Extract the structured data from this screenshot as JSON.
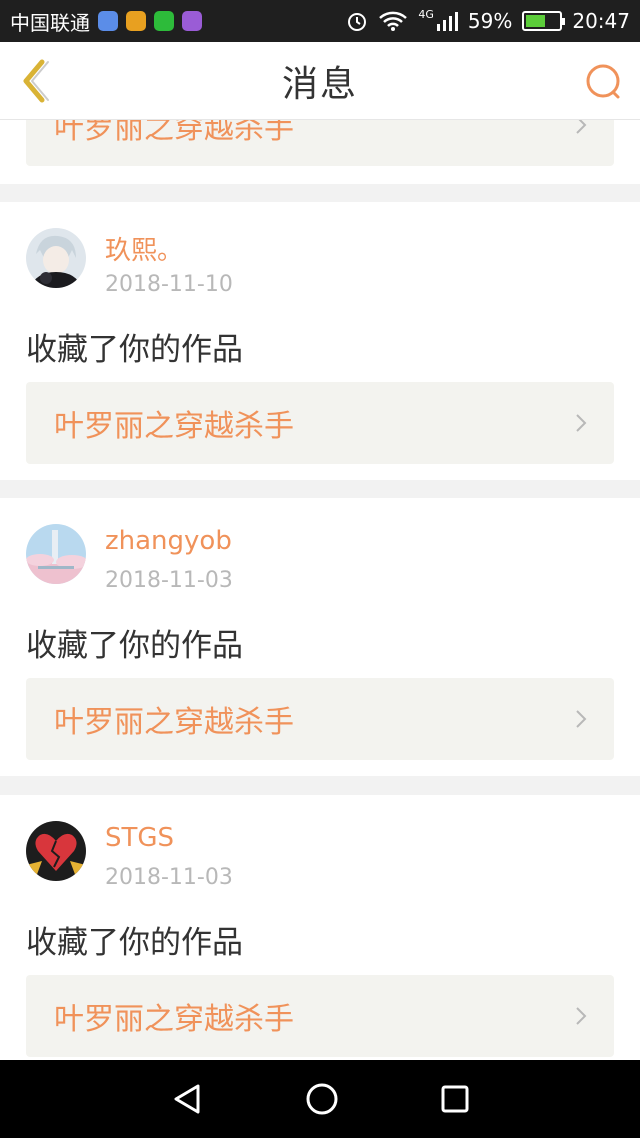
{
  "status_bar": {
    "carrier": "中国联通",
    "network": "4G",
    "battery_percent": "59%",
    "time": "20:47",
    "battery_level": 0.59,
    "icons": [
      "map-app-icon",
      "weibo-icon",
      "wechat-icon",
      "gallery-icon",
      "alarm-icon",
      "wifi-icon",
      "signal-icon",
      "battery-icon"
    ]
  },
  "header": {
    "title": "消息",
    "back_icon": "back-chevron-icon",
    "search_icon": "search-icon"
  },
  "top_partial": {
    "work_title": "叶罗丽之穿越杀手"
  },
  "messages": [
    {
      "username": "玖熙。",
      "date": "2018-11-10",
      "action": "收藏了你的作品",
      "work_title": "叶罗丽之穿越杀手"
    },
    {
      "username": "zhangyob",
      "date": "2018-11-03",
      "action": "收藏了你的作品",
      "work_title": "叶罗丽之穿越杀手"
    },
    {
      "username": "STGS",
      "date": "2018-11-03",
      "action": "收藏了你的作品",
      "work_title": "叶罗丽之穿越杀手"
    }
  ],
  "system_nav": [
    "back-triangle-icon",
    "home-circle-icon",
    "recents-square-icon"
  ],
  "colors": {
    "accent": "#f0925a",
    "nav_accent": "#d9b335",
    "text": "#333333",
    "muted": "#b8b8b8",
    "link_bg": "#f3f3ef"
  }
}
